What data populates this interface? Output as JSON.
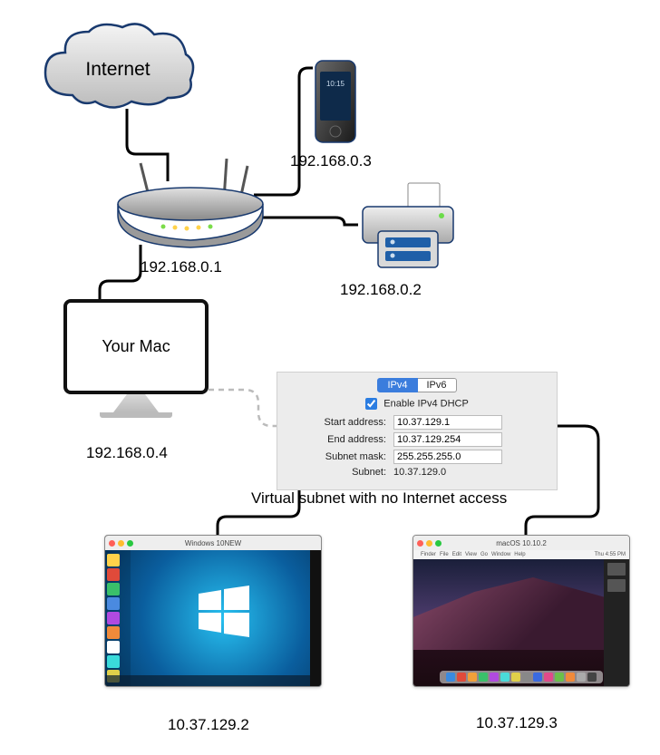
{
  "cloud": {
    "label": "Internet"
  },
  "router": {
    "ip": "192.168.0.1"
  },
  "phone": {
    "ip": "192.168.0.3"
  },
  "printer": {
    "ip": "192.168.0.2"
  },
  "mac": {
    "label": "Your Mac",
    "ip": "192.168.0.4"
  },
  "dhcp": {
    "tab_ipv4": "IPv4",
    "tab_ipv6": "IPv6",
    "enable_label": "Enable IPv4 DHCP",
    "start_label": "Start address:",
    "start_value": "10.37.129.1",
    "end_label": "End address:",
    "end_value": "10.37.129.254",
    "mask_label": "Subnet mask:",
    "mask_value": "255.255.255.0",
    "subnet_label": "Subnet:",
    "subnet_value": "10.37.129.0"
  },
  "subnet_caption": "Virtual subnet with no Internet access",
  "vm_windows": {
    "title": "Windows 10NEW",
    "ip": "10.37.129.2"
  },
  "vm_macos": {
    "title": "macOS 10.10.2",
    "ip": "10.37.129.3",
    "menu": [
      "Finder",
      "File",
      "Edit",
      "View",
      "Go",
      "Window",
      "Help"
    ],
    "clock": "Thu 4:55 PM"
  }
}
